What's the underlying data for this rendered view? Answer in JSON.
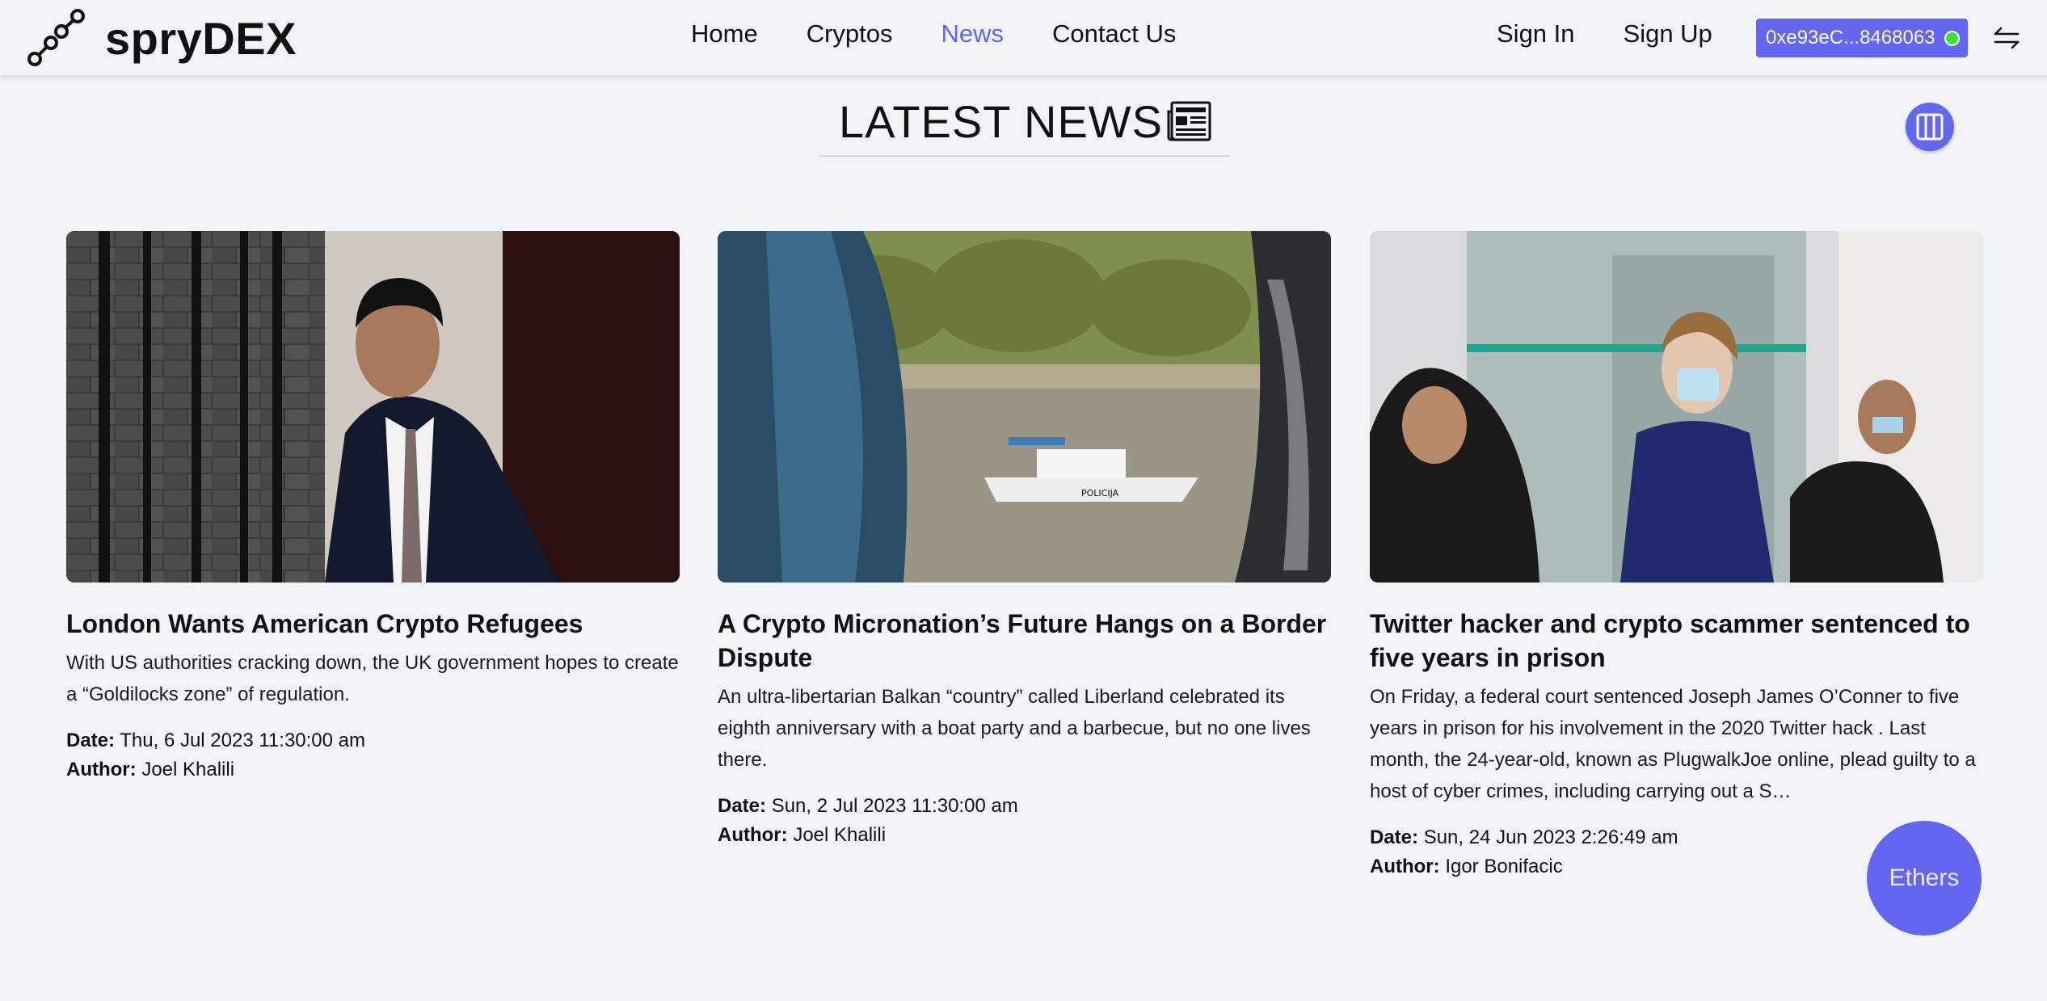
{
  "brand": {
    "name": "spryDEX"
  },
  "nav": {
    "home": "Home",
    "cryptos": "Cryptos",
    "news": "News",
    "contact": "Contact Us"
  },
  "auth": {
    "sign_in": "Sign In",
    "sign_up": "Sign Up"
  },
  "wallet": {
    "address": "0xe93eC...8468063",
    "status_color": "#3ddc3d"
  },
  "page": {
    "title": "LATEST NEWS"
  },
  "articles": [
    {
      "title": "London Wants American Crypto Refugees",
      "description": "With US authorities cracking down, the UK government hopes to create a “Goldilocks zone” of regulation.",
      "date_label": "Date:",
      "date": "Thu, 6 Jul 2023 11:30:00 am",
      "author_label": "Author:",
      "author": "Joel Khalili"
    },
    {
      "title": "A Crypto Micronation’s Future Hangs on a Border Dispute",
      "description": "An ultra-libertarian Balkan “country” called Liberland celebrated its eighth anniversary with a boat party and a barbecue, but no one lives there.",
      "date_label": "Date:",
      "date": "Sun, 2 Jul 2023 11:30:00 am",
      "author_label": "Author:",
      "author": "Joel Khalili"
    },
    {
      "title": "Twitter hacker and crypto scammer sentenced to five years in prison",
      "description": "On Friday, a federal court sentenced Joseph James O’Conner to five years in prison for his involvement in the 2020 Twitter hack . Last month, the 24-year-old, known as PlugwalkJoe online, plead guilty to a host of cyber crimes, including carrying out a S…",
      "date_label": "Date:",
      "date": "Sun, 24 Jun 2023 2:26:49 am",
      "author_label": "Author:",
      "author": "Igor Bonifacic"
    }
  ],
  "images": {
    "boat_label": "POLICIJA"
  },
  "fab": {
    "label": "Ethers"
  },
  "colors": {
    "accent": "#6366f1",
    "background": "#f0f4f9"
  }
}
